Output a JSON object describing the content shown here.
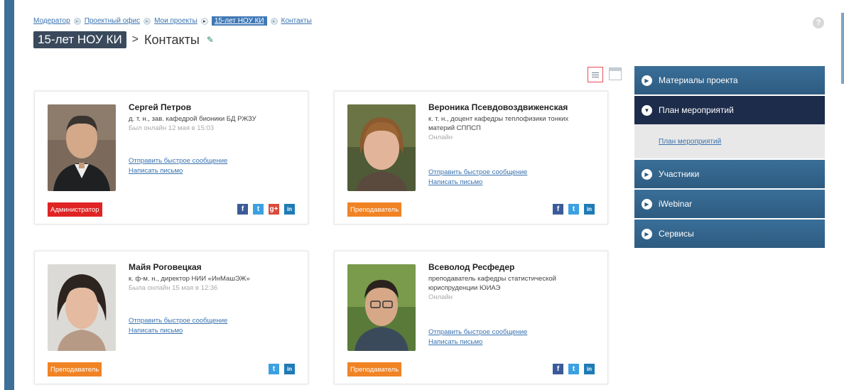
{
  "breadcrumb": [
    "Модератор",
    "Проектный офис",
    "Мои проекты",
    "15-лет НОУ КИ",
    "Контакты"
  ],
  "title": {
    "badge": "15-лет НОУ КИ",
    "separator": ">",
    "text": "Контакты"
  },
  "help": "?",
  "contacts": [
    {
      "name": "Сергей Петров",
      "desc": "д. т. н., зав. кафедрой бионики БД РЖЗУ",
      "status": "Был онлайн 12 мая в 15:03",
      "link_message": "Отправить быстрое сообщение",
      "link_mail": "Написать письмо",
      "role": "Администратор",
      "socials": [
        "facebook",
        "twitter",
        "google-plus",
        "linkedin"
      ]
    },
    {
      "name": "Вероника Псевдовоздвиженская",
      "desc": "к. т. н., доцент кафедры теплофизики тонких материй СППСП",
      "status": "Онлайн",
      "link_message": "Отправить быстрое сообщение",
      "link_mail": "Написать письмо",
      "role": "Преподаватель",
      "socials": [
        "facebook",
        "twitter",
        "linkedin"
      ]
    },
    {
      "name": "Майя Роговецкая",
      "desc": "к. ф-м. н., директор НИИ «ИнМашЭЖ»",
      "status": "Была онлайн 15 мая в 12:36",
      "link_message": "Отправить быстрое сообщение",
      "link_mail": "Написать письмо",
      "role": "Преподаватель",
      "socials": [
        "twitter",
        "linkedin"
      ]
    },
    {
      "name": "Всеволод Ресфедер",
      "desc": "преподаватель кафедры статистической юриспруденции ЮИАЭ",
      "status": "Онлайн",
      "link_message": "Отправить быстрое сообщение",
      "link_mail": "Написать письмо",
      "role": "Преподаватель",
      "socials": [
        "facebook",
        "twitter",
        "linkedin"
      ]
    }
  ],
  "menu": {
    "items": [
      "Материалы проекта",
      "План мероприятий",
      "Участники",
      "iWebinar",
      "Сервисы"
    ],
    "sub": "План мероприятий"
  },
  "colors": {
    "accent": "#3f78b5",
    "admin": "#e02424",
    "teacher": "#f08324",
    "menu": "#2e5b80",
    "menu_active": "#1d2c4a"
  }
}
